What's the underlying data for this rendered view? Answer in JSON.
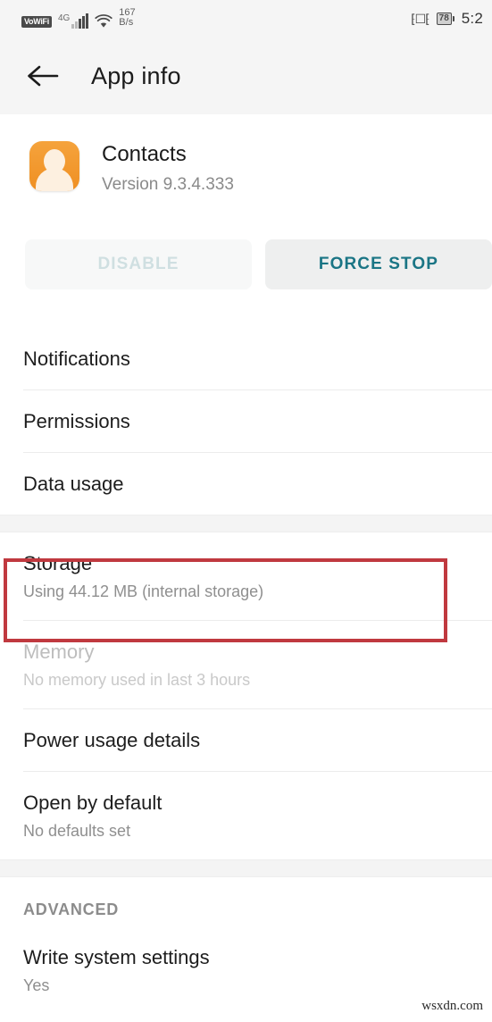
{
  "statusbar": {
    "vowifi_badge": "VoWiFi",
    "network_type": "4G",
    "net_speed_value": "167",
    "net_speed_unit": "B/s",
    "battery_percent": "78",
    "clock": "5:2",
    "icons": [
      "vowifi-icon",
      "signal-icon",
      "wifi-icon",
      "vibrate-icon",
      "battery-icon"
    ]
  },
  "appbar": {
    "back_icon": "back-arrow-icon",
    "title": "App info"
  },
  "app": {
    "name": "Contacts",
    "version": "Version 9.3.4.333",
    "icon_name": "contacts-app-icon",
    "icon_color": "#ef8f22"
  },
  "actions": {
    "disable_label": "DISABLE",
    "force_stop_label": "FORCE STOP",
    "disable_enabled": false,
    "accent_color": "#1a7585"
  },
  "list": [
    {
      "title": "Notifications",
      "subtitle": "",
      "disabled": false
    },
    {
      "title": "Permissions",
      "subtitle": "",
      "disabled": false
    },
    {
      "title": "Data usage",
      "subtitle": "",
      "disabled": false
    },
    {
      "title": "Storage",
      "subtitle": "Using 44.12 MB (internal storage)",
      "disabled": false
    },
    {
      "title": "Memory",
      "subtitle": "No memory used in last 3 hours",
      "disabled": true
    },
    {
      "title": "Power usage details",
      "subtitle": "",
      "disabled": false
    },
    {
      "title": "Open by default",
      "subtitle": "No defaults set",
      "disabled": false
    }
  ],
  "advanced": {
    "section_label": "ADVANCED",
    "items": [
      {
        "title": "Write system settings",
        "subtitle": "Yes"
      }
    ]
  },
  "annotation": {
    "highlight_target": "Storage",
    "color": "#c0393f"
  },
  "watermark": "wsxdn.com"
}
